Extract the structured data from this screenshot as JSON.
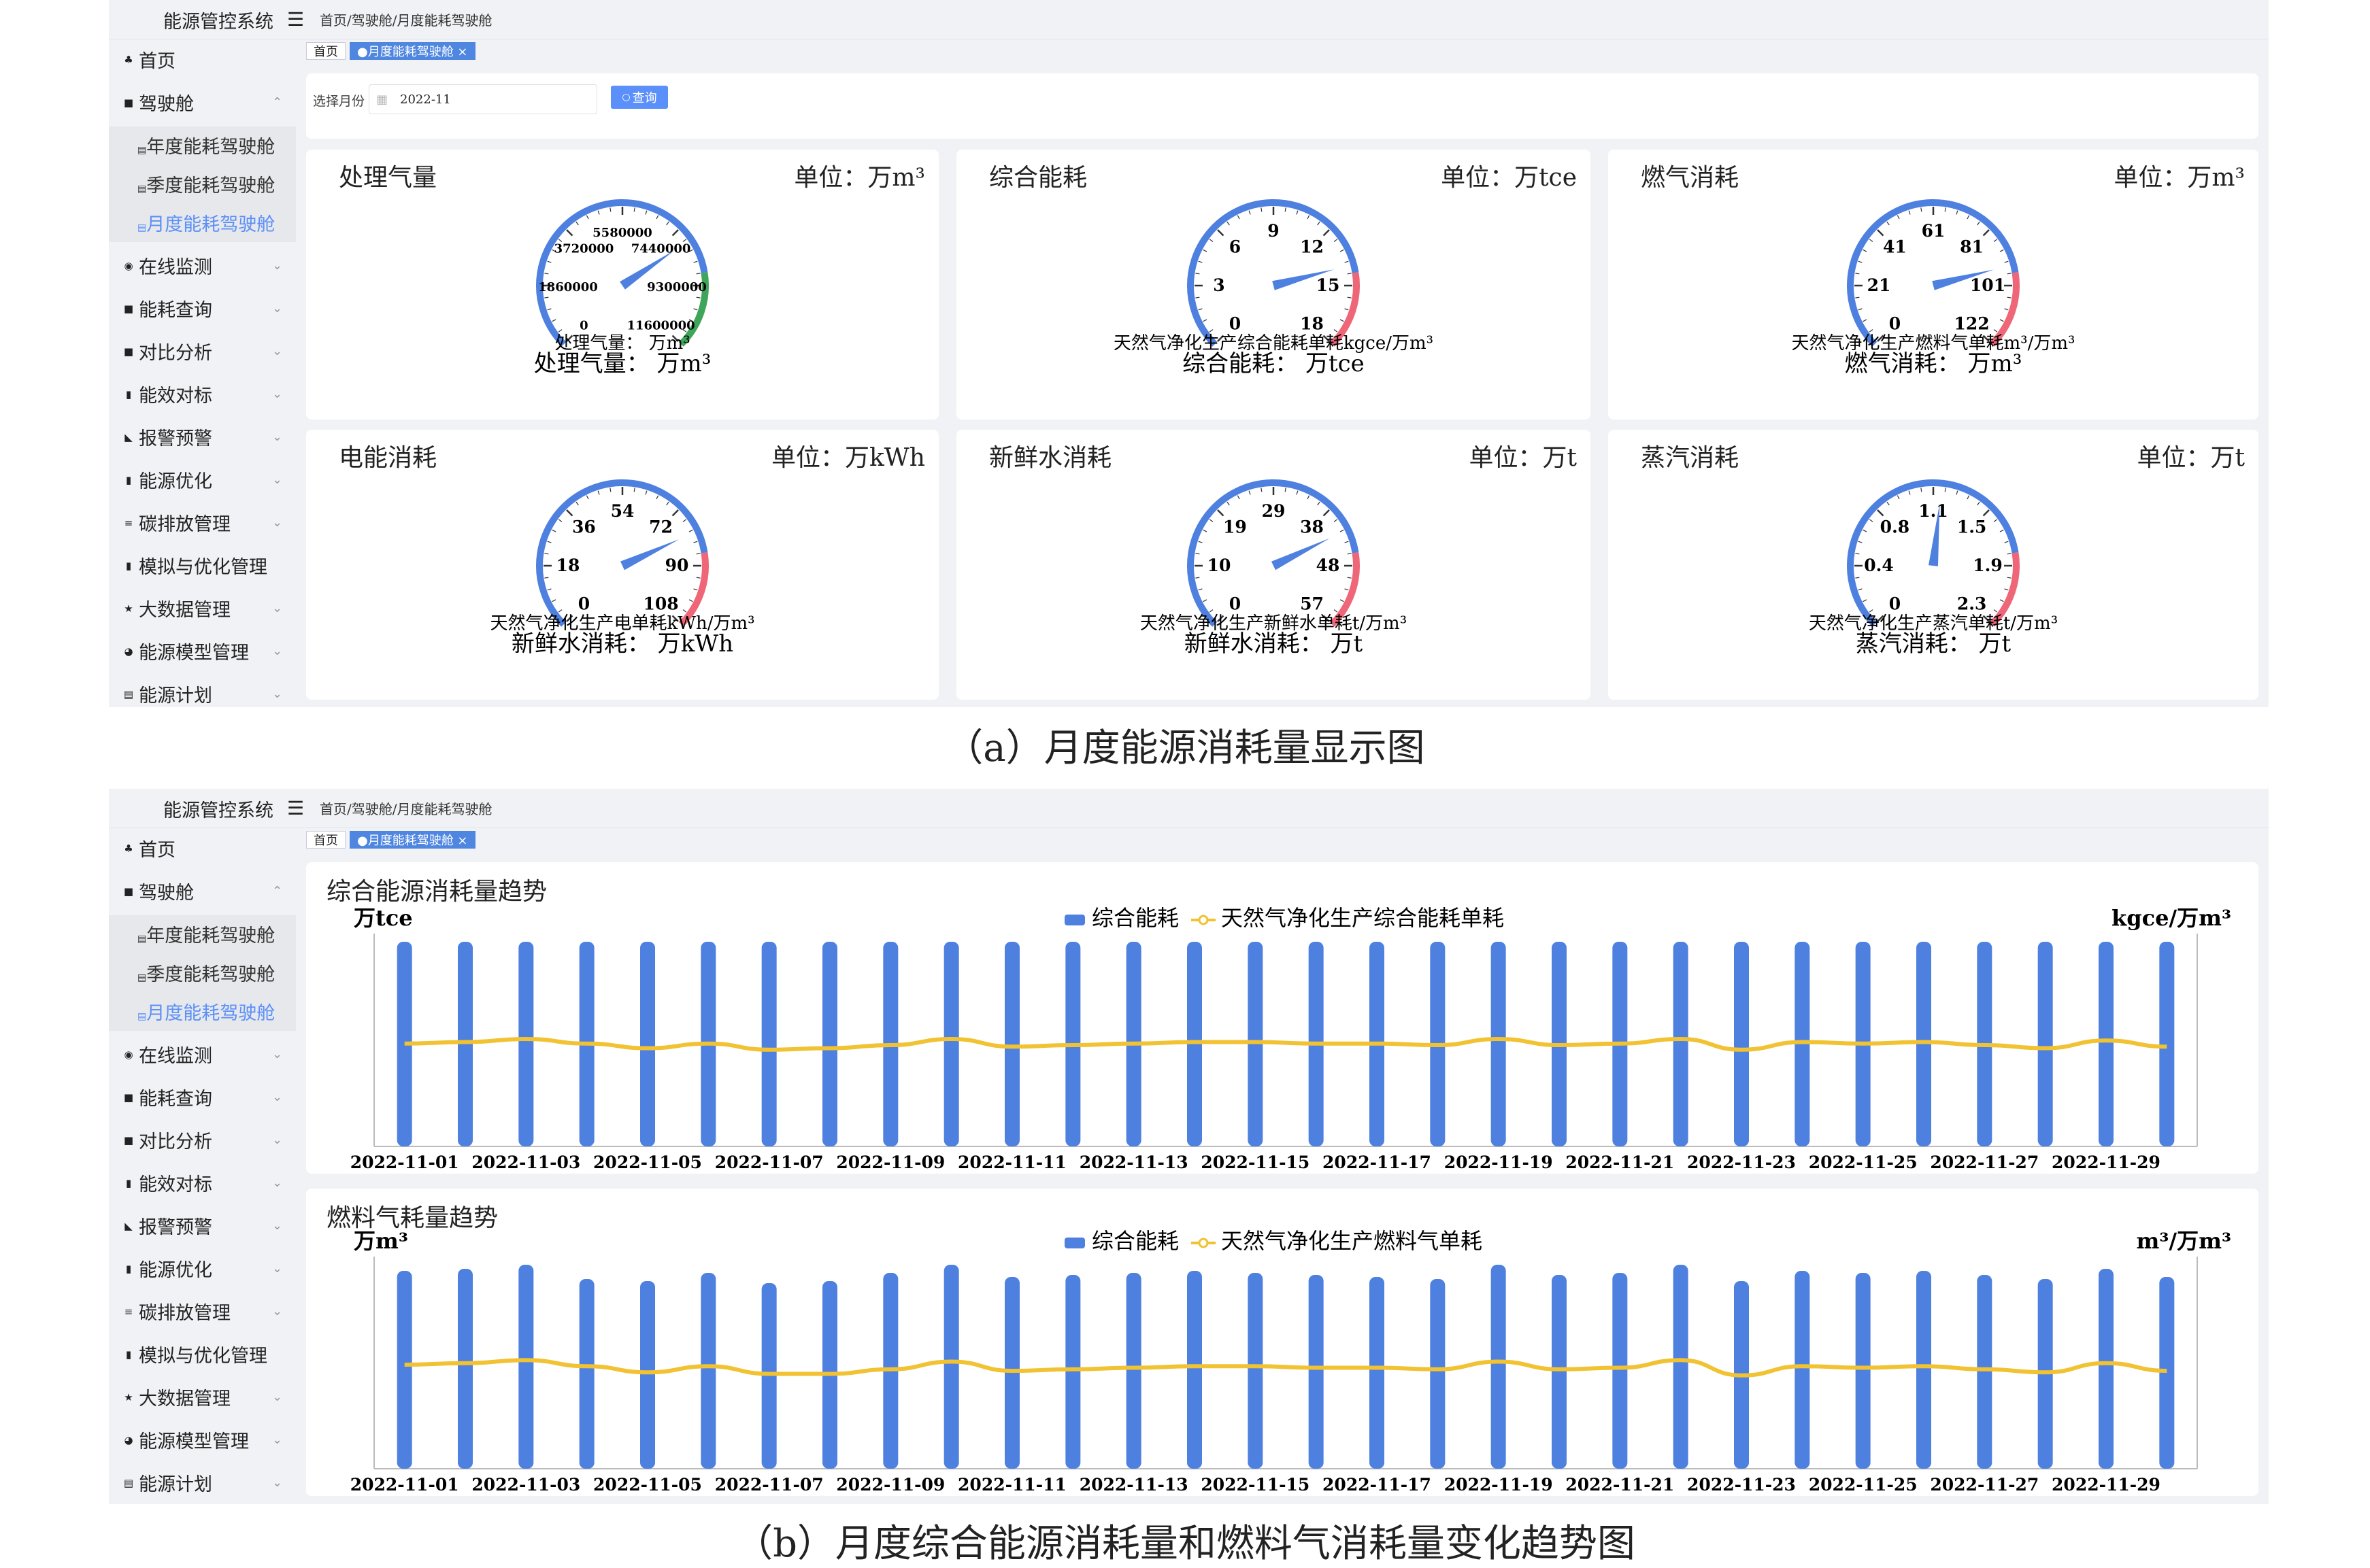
{
  "app": {
    "title": "能源管控系统",
    "breadcrumb": "首页/驾驶舱/月度能耗驾驶舱"
  },
  "sidebar": {
    "items": [
      {
        "label": "首页",
        "icon": "home-icon",
        "expandable": false
      },
      {
        "label": "驾驶舱",
        "icon": "dashboard-icon",
        "expandable": true,
        "expanded": true,
        "children": [
          "年度能耗驾驶舱",
          "季度能耗驾驶舱",
          "月度能耗驾驶舱"
        ],
        "active_child": "月度能耗驾驶舱"
      },
      {
        "label": "在线监测",
        "icon": "monitor-icon",
        "expandable": true
      },
      {
        "label": "能耗查询",
        "icon": "query-icon",
        "expandable": true
      },
      {
        "label": "对比分析",
        "icon": "compare-icon",
        "expandable": true
      },
      {
        "label": "能效对标",
        "icon": "bar-chart-icon",
        "expandable": true
      },
      {
        "label": "报警预警",
        "icon": "alarm-icon",
        "expandable": true
      },
      {
        "label": "能源优化",
        "icon": "optimize-icon",
        "expandable": true
      },
      {
        "label": "碳排放管理",
        "icon": "carbon-icon",
        "expandable": true
      },
      {
        "label": "模拟与优化管理",
        "icon": "simulation-icon",
        "expandable": false
      },
      {
        "label": "大数据管理",
        "icon": "star-icon",
        "expandable": true
      },
      {
        "label": "能源模型管理",
        "icon": "model-icon",
        "expandable": true
      },
      {
        "label": "能源计划",
        "icon": "plan-icon",
        "expandable": true
      }
    ]
  },
  "tabs": [
    {
      "label": "首页",
      "active": false
    },
    {
      "label": "●月度能耗驾驶舱 ×",
      "active": true
    }
  ],
  "query": {
    "label": "选择月份",
    "value": "2022-11",
    "button": "查询"
  },
  "gauges": [
    {
      "title": "处理气量",
      "unit_label": "单位：万m³",
      "ticks": [
        "0",
        "1860000",
        "3720000",
        "5580000",
        "7440000",
        "9300000",
        "11600000"
      ],
      "min": 0,
      "max": 11600000,
      "value": 8200000,
      "desc": "处理气量：  万m³",
      "footer": "处理气量：  万m³",
      "ring": "blue-green"
    },
    {
      "title": "综合能耗",
      "unit_label": "单位：万tce",
      "ticks": [
        "0",
        "3",
        "6",
        "9",
        "12",
        "15",
        "18"
      ],
      "min": 0,
      "max": 18,
      "value": 14,
      "desc": "天然气净化生产综合能耗单耗kgce/万m³",
      "footer": "综合能耗：  万tce",
      "ring": "blue-red"
    },
    {
      "title": "燃气消耗",
      "unit_label": "单位：万m³",
      "ticks": [
        "0",
        "21",
        "41",
        "61",
        "81",
        "101",
        "122"
      ],
      "min": 0,
      "max": 122,
      "value": 95,
      "desc": "天然气净化生产燃料气单耗m³/万m³",
      "footer": "燃气消耗：  万m³",
      "ring": "blue-red"
    },
    {
      "title": "电能消耗",
      "unit_label": "单位：万kWh",
      "ticks": [
        "0",
        "18",
        "36",
        "54",
        "72",
        "90",
        "108"
      ],
      "min": 0,
      "max": 108,
      "value": 80,
      "desc": "天然气净化生产电单耗kWh/万m³",
      "footer": "新鲜水消耗：  万kWh",
      "ring": "blue-red"
    },
    {
      "title": "新鲜水消耗",
      "unit_label": "单位：万t",
      "ticks": [
        "0",
        "10",
        "19",
        "29",
        "38",
        "48",
        "57"
      ],
      "min": 0,
      "max": 57,
      "value": 42,
      "desc": "天然气净化生产新鲜水单耗t/万m³",
      "footer": "新鲜水消耗：  万t",
      "ring": "blue-red"
    },
    {
      "title": "蒸汽消耗",
      "unit_label": "单位：万t",
      "ticks": [
        "0",
        "0.4",
        "0.8",
        "1.1",
        "1.5",
        "1.9",
        "2.3"
      ],
      "min": 0,
      "max": 2.3,
      "value": 1.2,
      "desc": "天然气净化生产蒸汽单耗t/万m³",
      "footer": "蒸汽消耗：  万t",
      "ring": "blue-red"
    }
  ],
  "chart_data": [
    {
      "type": "bar",
      "title": "综合能源消耗量趋势",
      "ylabel": "万tce",
      "y2label": "kgce/万m³",
      "x": [
        "2022-11-01",
        "2022-11-02",
        "2022-11-03",
        "2022-11-04",
        "2022-11-05",
        "2022-11-06",
        "2022-11-07",
        "2022-11-08",
        "2022-11-09",
        "2022-11-10",
        "2022-11-11",
        "2022-11-12",
        "2022-11-13",
        "2022-11-14",
        "2022-11-15",
        "2022-11-16",
        "2022-11-17",
        "2022-11-18",
        "2022-11-19",
        "2022-11-20",
        "2022-11-21",
        "2022-11-22",
        "2022-11-23",
        "2022-11-24",
        "2022-11-25",
        "2022-11-26",
        "2022-11-27",
        "2022-11-28",
        "2022-11-29",
        "2022-11-30"
      ],
      "tick_labels": [
        "2022-11-01",
        "2022-11-03",
        "2022-11-05",
        "2022-11-07",
        "2022-11-09",
        "2022-11-11",
        "2022-11-13",
        "2022-11-15",
        "2022-11-17",
        "2022-11-19",
        "2022-11-21",
        "2022-11-23",
        "2022-11-25",
        "2022-11-27",
        "2022-11-29"
      ],
      "series": [
        {
          "name": "综合能耗",
          "kind": "bar",
          "color": "#4e80e0",
          "values": [
            100,
            100,
            100,
            100,
            100,
            100,
            100,
            100,
            100,
            100,
            100,
            100,
            100,
            100,
            100,
            100,
            100,
            100,
            100,
            100,
            100,
            100,
            100,
            100,
            100,
            100,
            100,
            100,
            100,
            100
          ]
        },
        {
          "name": "天然气净化生产综合能耗单耗",
          "kind": "line",
          "color": "#f1c232",
          "values": [
            67,
            68,
            70,
            67,
            64,
            67,
            63,
            64,
            66,
            70,
            65,
            66,
            67,
            68,
            68,
            67,
            67,
            66,
            70,
            66,
            67,
            70,
            63,
            68,
            67,
            68,
            66,
            64,
            69,
            65
          ]
        }
      ],
      "ylim": [
        0,
        100
      ]
    },
    {
      "type": "bar",
      "title": "燃料气耗量趋势",
      "ylabel": "万m³",
      "y2label": "m³/万m³",
      "x": [
        "2022-11-01",
        "2022-11-02",
        "2022-11-03",
        "2022-11-04",
        "2022-11-05",
        "2022-11-06",
        "2022-11-07",
        "2022-11-08",
        "2022-11-09",
        "2022-11-10",
        "2022-11-11",
        "2022-11-12",
        "2022-11-13",
        "2022-11-14",
        "2022-11-15",
        "2022-11-16",
        "2022-11-17",
        "2022-11-18",
        "2022-11-19",
        "2022-11-20",
        "2022-11-21",
        "2022-11-22",
        "2022-11-23",
        "2022-11-24",
        "2022-11-25",
        "2022-11-26",
        "2022-11-27",
        "2022-11-28",
        "2022-11-29",
        "2022-11-30"
      ],
      "tick_labels": [
        "2022-11-01",
        "2022-11-03",
        "2022-11-05",
        "2022-11-07",
        "2022-11-09",
        "2022-11-11",
        "2022-11-13",
        "2022-11-15",
        "2022-11-17",
        "2022-11-19",
        "2022-11-21",
        "2022-11-23",
        "2022-11-25",
        "2022-11-27",
        "2022-11-29"
      ],
      "series": [
        {
          "name": "综合能耗",
          "kind": "bar",
          "color": "#4e80e0",
          "values": [
            97,
            98,
            100,
            93,
            92,
            96,
            91,
            92,
            96,
            100,
            94,
            95,
            96,
            97,
            96,
            95,
            94,
            93,
            100,
            95,
            96,
            100,
            92,
            97,
            96,
            97,
            95,
            93,
            98,
            94
          ]
        },
        {
          "name": "天然气净化生产燃料气单耗",
          "kind": "line",
          "color": "#f1c232",
          "values": [
            68,
            69,
            71,
            67,
            63,
            67,
            62,
            62,
            65,
            70,
            64,
            65,
            66,
            67,
            67,
            66,
            66,
            65,
            70,
            65,
            66,
            71,
            61,
            67,
            66,
            67,
            65,
            63,
            69,
            64
          ]
        }
      ],
      "ylim": [
        0,
        100
      ]
    }
  ],
  "captions": [
    "（a）月度能源消耗量显示图",
    "（b）月度综合能源消耗量和燃料气消耗量变化趋势图"
  ]
}
